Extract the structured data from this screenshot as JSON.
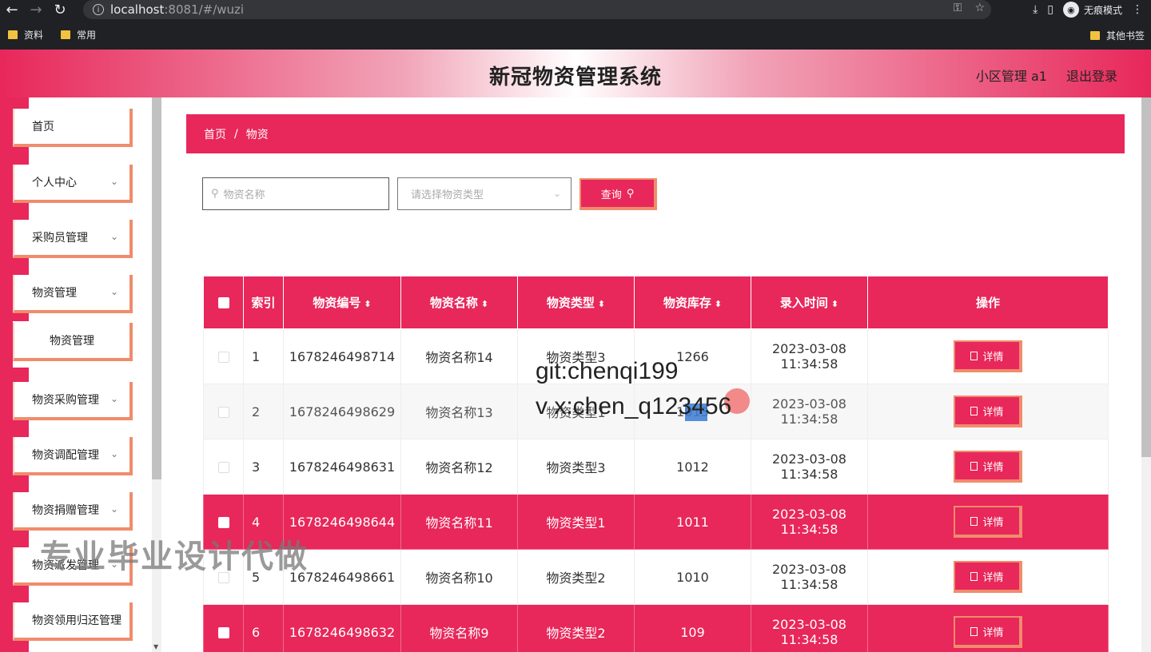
{
  "browser": {
    "url_host": "localhost",
    "url_rest": ":8081/#/wuzi",
    "incognito_label": "无痕模式",
    "bookmarks": [
      "资料",
      "常用"
    ],
    "other_bookmarks": "其他书签"
  },
  "header": {
    "title": "新冠物资管理系统",
    "user": "小区管理 a1",
    "logout": "退出登录"
  },
  "sidebar": {
    "items": [
      {
        "label": "首页"
      },
      {
        "label": "个人中心"
      },
      {
        "label": "采购员管理"
      },
      {
        "label": "物资管理"
      },
      {
        "label": "物资管理"
      },
      {
        "label": "物资采购管理"
      },
      {
        "label": "物资调配管理"
      },
      {
        "label": "物资捐赠管理"
      },
      {
        "label": "物资派发管理"
      },
      {
        "label": "物资领用归还管理"
      }
    ]
  },
  "breadcrumb": {
    "home": "首页",
    "sep": "/",
    "current": "物资"
  },
  "search": {
    "name_placeholder": "物资名称",
    "type_placeholder": "请选择物资类型",
    "query_label": "查询"
  },
  "table": {
    "headers": {
      "index": "索引",
      "code": "物资编号",
      "name": "物资名称",
      "type": "物资类型",
      "stock": "物资库存",
      "time": "录入时间",
      "action": "操作"
    },
    "detail_label": "详情",
    "rows": [
      {
        "idx": "1",
        "code": "1678246498714",
        "name": "物资名称14",
        "type": "物资类型3",
        "stock": "1266",
        "time": "2023-03-08 11:34:58"
      },
      {
        "idx": "2",
        "code": "1678246498629",
        "name": "物资名称13",
        "type": "物资类型1",
        "stock": "1013",
        "time": "2023-03-08 11:34:58"
      },
      {
        "idx": "3",
        "code": "1678246498631",
        "name": "物资名称12",
        "type": "物资类型3",
        "stock": "1012",
        "time": "2023-03-08 11:34:58"
      },
      {
        "idx": "4",
        "code": "1678246498644",
        "name": "物资名称11",
        "type": "物资类型1",
        "stock": "1011",
        "time": "2023-03-08 11:34:58"
      },
      {
        "idx": "5",
        "code": "1678246498661",
        "name": "物资名称10",
        "type": "物资类型2",
        "stock": "1010",
        "time": "2023-03-08 11:34:58"
      },
      {
        "idx": "6",
        "code": "1678246498632",
        "name": "物资名称9",
        "type": "物资类型2",
        "stock": "109",
        "time": "2023-03-08 11:34:58"
      }
    ]
  },
  "overlays": {
    "git": "git:chenqi199",
    "vx": "v x:chen_q123456",
    "promo": "专业毕业设计代做"
  }
}
